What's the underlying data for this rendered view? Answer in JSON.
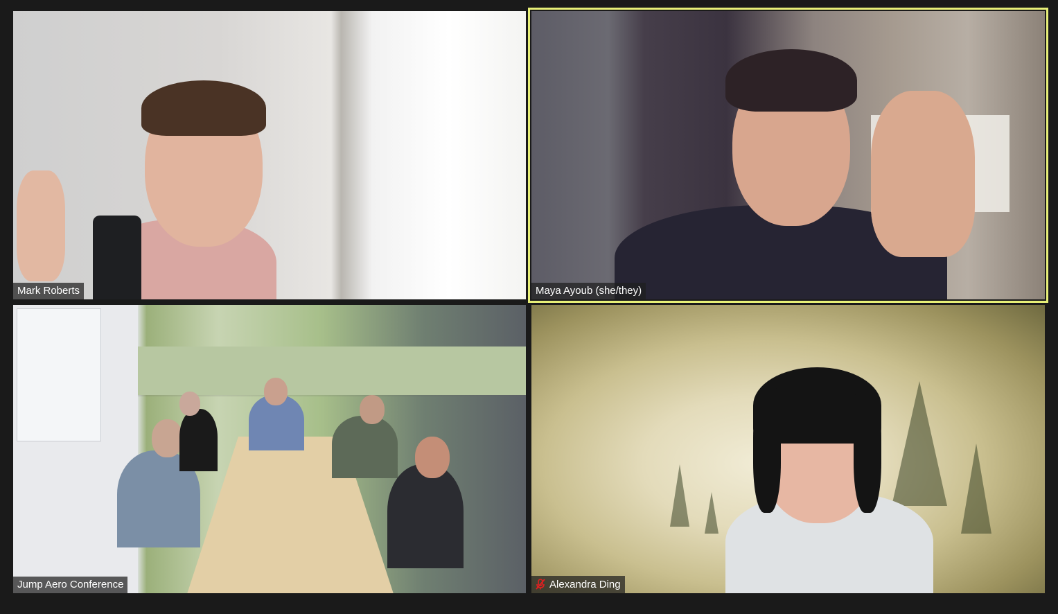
{
  "window": {
    "background_color": "#1a1a1a",
    "active_speaker_outline_color": "#e8f078"
  },
  "participants": [
    {
      "name": "Mark Roberts",
      "muted": false,
      "active_speaker": false
    },
    {
      "name": "Maya Ayoub (she/they)",
      "muted": false,
      "active_speaker": true
    },
    {
      "name": "Jump Aero Conference",
      "muted": false,
      "active_speaker": false
    },
    {
      "name": "Alexandra Ding",
      "muted": true,
      "active_speaker": false,
      "mic_icon": "mic-muted-icon",
      "mic_icon_color": "#e02020"
    }
  ]
}
